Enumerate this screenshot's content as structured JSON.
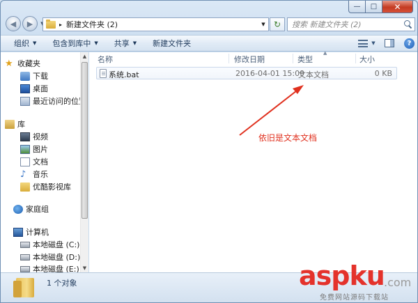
{
  "window": {
    "close_glyph": "✕",
    "minimize_glyph": "—",
    "maximize_glyph": "□"
  },
  "address_bar": {
    "path_segment": "新建文件夹 (2)",
    "separator": "▸"
  },
  "search": {
    "placeholder": "搜索 新建文件夹 (2)"
  },
  "toolbar": {
    "organize": "组织",
    "include_in_library": "包含到库中",
    "share": "共享",
    "new_folder": "新建文件夹",
    "help_glyph": "?"
  },
  "nav_pane": {
    "favorites": "收藏夹",
    "downloads": "下载",
    "desktop": "桌面",
    "recent": "最近访问的位置",
    "libraries": "库",
    "videos": "视频",
    "pictures": "图片",
    "documents": "文档",
    "music": "音乐",
    "youku": "优酷影视库",
    "homegroup": "家庭组",
    "computer": "计算机",
    "disk_c": "本地磁盘 (C:)",
    "disk_d": "本地磁盘 (D:)",
    "disk_e": "本地磁盘 (E:)"
  },
  "columns": {
    "name": "名称",
    "modified": "修改日期",
    "type": "类型",
    "size": "大小"
  },
  "files": [
    {
      "name": "系统.bat",
      "modified": "2016-04-01 15:09",
      "type": "文本文档",
      "size": "0 KB"
    }
  ],
  "annotation": {
    "text": "依旧是文本文档",
    "color": "#e0301e"
  },
  "status": {
    "count": "1 个对象"
  },
  "watermark": {
    "brand": "aspku",
    "domain": ".com",
    "tagline": "免费网站源码下载站"
  }
}
